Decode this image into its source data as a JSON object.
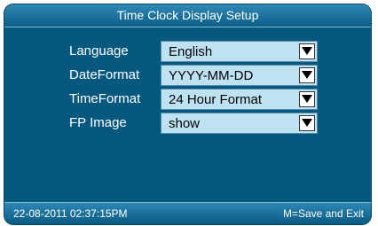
{
  "window": {
    "title": "Time Clock Display Setup"
  },
  "settings": [
    {
      "label": "Language",
      "value": "English",
      "icon": "dropdown-arrow-icon"
    },
    {
      "label": "DateFormat",
      "value": "YYYY-MM-DD",
      "icon": "dropdown-arrow-icon"
    },
    {
      "label": "TimeFormat",
      "value": "24 Hour Format",
      "icon": "dropdown-arrow-icon"
    },
    {
      "label": "FP Image",
      "value": "show",
      "icon": "dropdown-arrow-icon"
    }
  ],
  "status_bar": {
    "datetime": "22-08-2011  02:37:15PM",
    "hint": "M=Save and Exit"
  },
  "colors": {
    "background": "#06587f",
    "title_bar": "#1f76a0",
    "dropdown_fill": "#bfe2f3",
    "text": "#ffffff"
  }
}
